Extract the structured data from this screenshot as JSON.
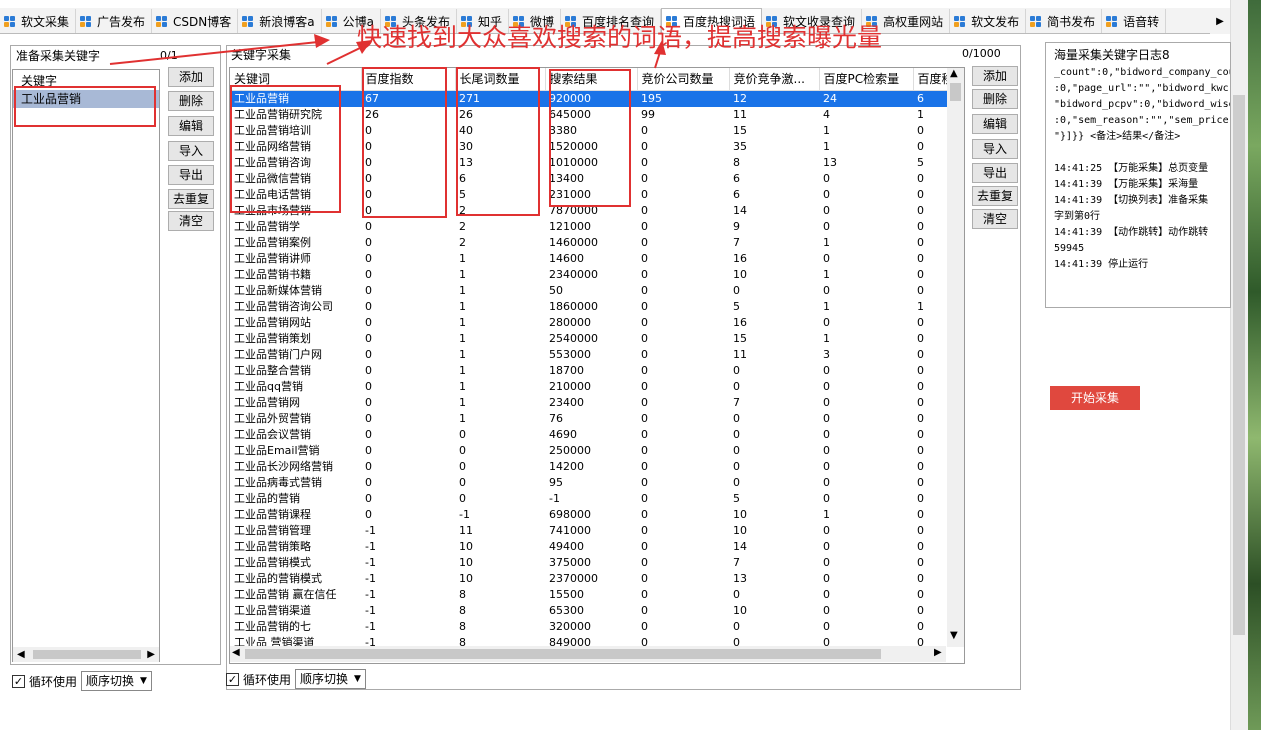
{
  "tabs": [
    {
      "label": "软文采集",
      "active": false
    },
    {
      "label": "广告发布",
      "active": false
    },
    {
      "label": "CSDN博客",
      "active": false
    },
    {
      "label": "新浪博客a",
      "active": false
    },
    {
      "label": "公博a",
      "active": false
    },
    {
      "label": "头条发布",
      "active": false
    },
    {
      "label": "知乎",
      "active": false
    },
    {
      "label": "微博",
      "active": false
    },
    {
      "label": "百度排名查询",
      "active": false
    },
    {
      "label": "百度热搜词语",
      "active": true
    },
    {
      "label": "软文收录查询",
      "active": false
    },
    {
      "label": "高权重网站",
      "active": false
    },
    {
      "label": "软文发布",
      "active": false
    },
    {
      "label": "简书发布",
      "active": false
    },
    {
      "label": "语音转",
      "active": false
    }
  ],
  "left": {
    "title": "准备采集关键字",
    "count": "0/1",
    "header": "关键字",
    "items": [
      "工业品营销"
    ],
    "buttons": {
      "add": "添加",
      "delete": "删除",
      "edit": "编辑",
      "import": "导入",
      "export": "导出",
      "dedup": "去重复",
      "clear": "清空"
    },
    "loop_label": "循环使用",
    "loop_checked": "✓",
    "mode": "顺序切换"
  },
  "middle": {
    "title": "关键字采集",
    "count": "0/1000",
    "columns": [
      "关键词",
      "百度指数",
      "长尾词数量",
      "搜索结果",
      "竞价公司数量",
      "竞价竞争激...",
      "百度PC检索量",
      "百度移"
    ],
    "rows": [
      [
        "工业品营销",
        "67",
        "271",
        "920000",
        "195",
        "12",
        "24",
        "6"
      ],
      [
        "工业品营销研究院",
        "26",
        "26",
        "645000",
        "99",
        "11",
        "4",
        "1"
      ],
      [
        "工业品营销培训",
        "0",
        "40",
        "3380",
        "0",
        "15",
        "1",
        "0"
      ],
      [
        "工业品网络营销",
        "0",
        "30",
        "1520000",
        "0",
        "35",
        "1",
        "0"
      ],
      [
        "工业品营销咨询",
        "0",
        "13",
        "1010000",
        "0",
        "8",
        "13",
        "5"
      ],
      [
        "工业品微信营销",
        "0",
        "6",
        "13400",
        "0",
        "6",
        "0",
        "0"
      ],
      [
        "工业品电话营销",
        "0",
        "5",
        "231000",
        "0",
        "6",
        "0",
        "0"
      ],
      [
        "工业品市场营销",
        "0",
        "2",
        "7870000",
        "0",
        "14",
        "0",
        "0"
      ],
      [
        "工业品营销学",
        "0",
        "2",
        "121000",
        "0",
        "9",
        "0",
        "0"
      ],
      [
        "工业品营销案例",
        "0",
        "2",
        "1460000",
        "0",
        "7",
        "1",
        "0"
      ],
      [
        "工业品营销讲师",
        "0",
        "1",
        "14600",
        "0",
        "16",
        "0",
        "0"
      ],
      [
        "工业品营销书籍",
        "0",
        "1",
        "2340000",
        "0",
        "10",
        "1",
        "0"
      ],
      [
        "工业品新媒体营销",
        "0",
        "1",
        "50",
        "0",
        "0",
        "0",
        "0"
      ],
      [
        "工业品营销咨询公司",
        "0",
        "1",
        "1860000",
        "0",
        "5",
        "1",
        "1"
      ],
      [
        "工业品营销网站",
        "0",
        "1",
        "280000",
        "0",
        "16",
        "0",
        "0"
      ],
      [
        "工业品营销策划",
        "0",
        "1",
        "2540000",
        "0",
        "15",
        "1",
        "0"
      ],
      [
        "工业品营销门户网",
        "0",
        "1",
        "553000",
        "0",
        "11",
        "3",
        "0"
      ],
      [
        "工业品整合营销",
        "0",
        "1",
        "18700",
        "0",
        "0",
        "0",
        "0"
      ],
      [
        "工业品qq营销",
        "0",
        "1",
        "210000",
        "0",
        "0",
        "0",
        "0"
      ],
      [
        "工业品营销网",
        "0",
        "1",
        "23400",
        "0",
        "7",
        "0",
        "0"
      ],
      [
        "工业品外贸营销",
        "0",
        "1",
        "76",
        "0",
        "0",
        "0",
        "0"
      ],
      [
        "工业品会议营销",
        "0",
        "0",
        "4690",
        "0",
        "0",
        "0",
        "0"
      ],
      [
        "工业品Email营销",
        "0",
        "0",
        "250000",
        "0",
        "0",
        "0",
        "0"
      ],
      [
        "工业品长沙网络营销",
        "0",
        "0",
        "14200",
        "0",
        "0",
        "0",
        "0"
      ],
      [
        "工业品病毒式营销",
        "0",
        "0",
        "95",
        "0",
        "0",
        "0",
        "0"
      ],
      [
        "工业品的营销",
        "0",
        "0",
        "-1",
        "0",
        "5",
        "0",
        "0"
      ],
      [
        "工业品营销课程",
        "0",
        "-1",
        "698000",
        "0",
        "10",
        "1",
        "0"
      ],
      [
        "工业品营销管理",
        "-1",
        "11",
        "741000",
        "0",
        "10",
        "0",
        "0"
      ],
      [
        "工业品营销策略",
        "-1",
        "10",
        "49400",
        "0",
        "14",
        "0",
        "0"
      ],
      [
        "工业品营销模式",
        "-1",
        "10",
        "375000",
        "0",
        "7",
        "0",
        "0"
      ],
      [
        "工业品的营销模式",
        "-1",
        "10",
        "2370000",
        "0",
        "13",
        "0",
        "0"
      ],
      [
        "工业品营销 赢在信任",
        "-1",
        "8",
        "15500",
        "0",
        "0",
        "0",
        "0"
      ],
      [
        "工业品营销渠道",
        "-1",
        "8",
        "65300",
        "0",
        "10",
        "0",
        "0"
      ],
      [
        "工业品营销的七",
        "-1",
        "8",
        "320000",
        "0",
        "0",
        "0",
        "0"
      ],
      [
        "工业品 营销渠道",
        "-1",
        "8",
        "849000",
        "0",
        "0",
        "0",
        "0"
      ]
    ],
    "buttons": {
      "add": "添加",
      "delete": "删除",
      "edit": "编辑",
      "import": "导入",
      "export": "导出",
      "dedup": "去重复",
      "clear": "清空"
    },
    "loop_label": "循环使用",
    "loop_checked": "✓",
    "mode": "顺序切换"
  },
  "log": {
    "title": "海量采集关键字日志8",
    "lines": [
      "_count\":0,\"bidword_company_cou",
      ":0,\"page_url\":\"\",\"bidword_kwc",
      "\"bidword_pcpv\":0,\"bidword_wise",
      ":0,\"sem_reason\":\"\",\"sem_price",
      "\"}]}} <备注>结果</备注>",
      "",
      "14:41:25 【万能采集】总页变量",
      "14:41:39 【万能采集】采海量",
      "14:41:39 【切换列表】准备采集",
      "字到第0行",
      "14:41:39 【动作跳转】动作跳转",
      "59945",
      "14:41:39 停止运行"
    ]
  },
  "start_button": "开始采集",
  "annotation": {
    "text": "快速找到大众喜欢搜索的词语，提高搜索曝光量",
    "color": "#e03131"
  },
  "colors": {
    "selection": "#1a73e8",
    "start_button": "#e0483e",
    "left_selection": "#a8b9d6"
  }
}
